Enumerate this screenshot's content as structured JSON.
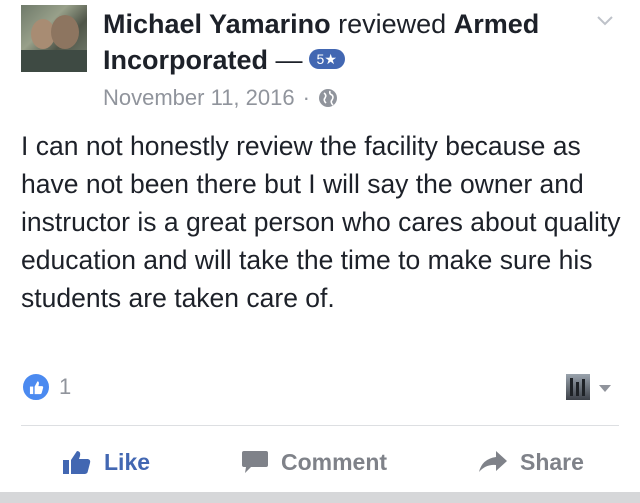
{
  "post": {
    "author": "Michael Yamarino",
    "action_text": "reviewed",
    "page_name_line1": "Armed",
    "page_name_line2": "Incorporated",
    "dash": "—",
    "rating_badge": "5★",
    "date": "November 11, 2016",
    "separator": "·",
    "privacy_icon": "globe-icon",
    "body": "I can not honestly review the facility because as have not been there but I will say the owner and instructor is a great person who cares about quality education and will take the time to make sure his students are taken care of."
  },
  "reactions": {
    "icon": "thumbs-up-icon",
    "count": "1"
  },
  "actions": {
    "like_label": "Like",
    "comment_label": "Comment",
    "share_label": "Share"
  },
  "colors": {
    "accent": "#4267b2",
    "text": "#1d2129",
    "muted": "#90949c",
    "reaction_blue": "#4b8af0"
  }
}
